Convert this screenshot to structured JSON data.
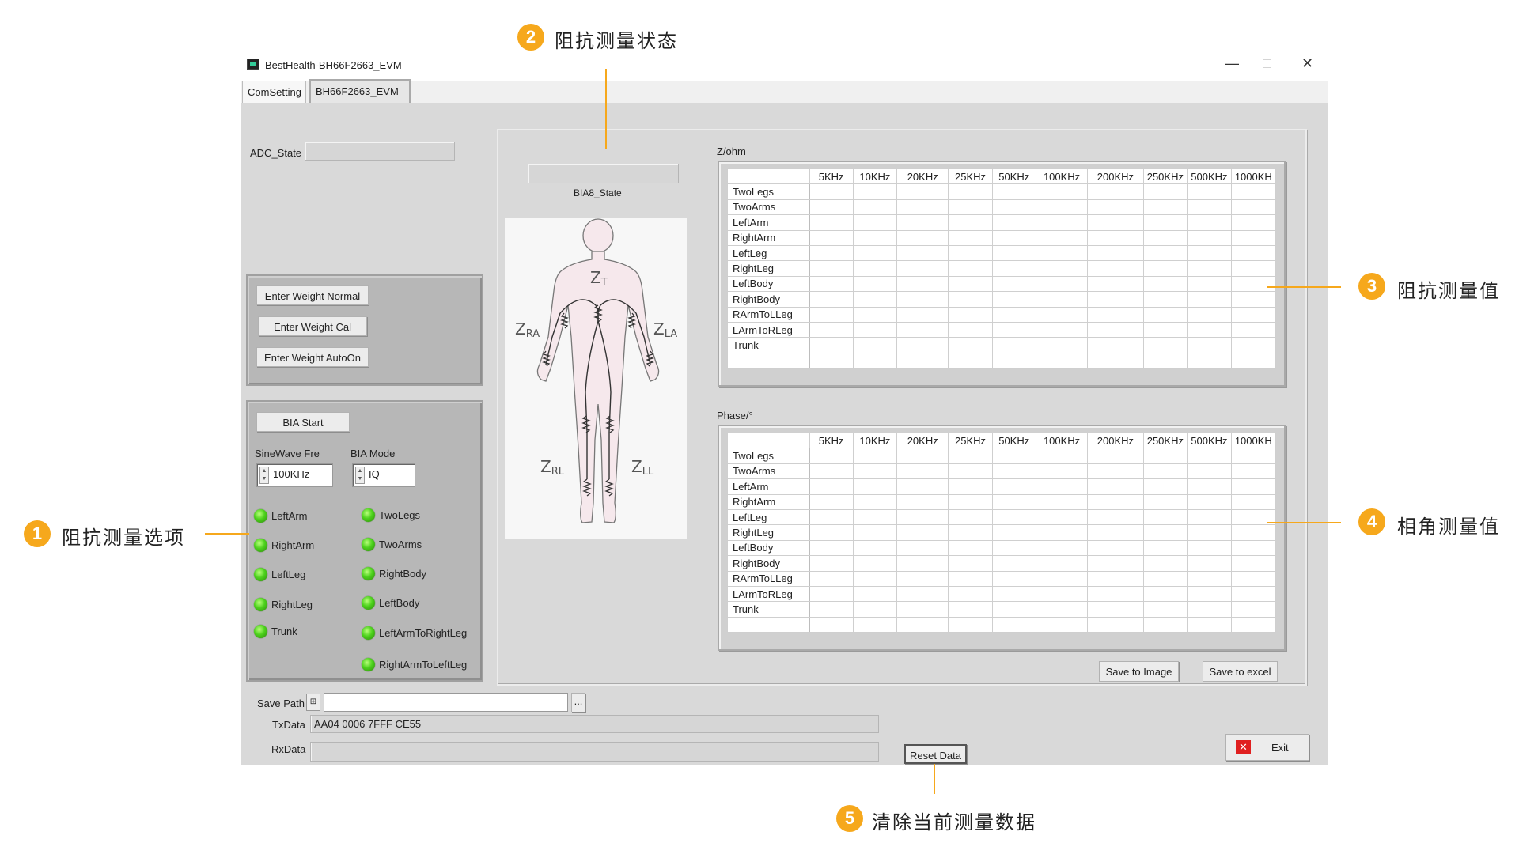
{
  "window": {
    "title": "BestHealth-BH66F2663_EVM",
    "controls": [
      "—",
      "□",
      "✕"
    ]
  },
  "tabs": [
    {
      "label": "ComSetting"
    },
    {
      "label": "BH66F2663_EVM",
      "active": true
    }
  ],
  "left": {
    "adc_state_label": "ADC_State",
    "adc_state_value": "",
    "weight_buttons": [
      "Enter Weight Normal",
      "Enter Weight Cal",
      "Enter Weight AutoOn"
    ],
    "bia_start_label": "BIA Start",
    "sinewave_label": "SineWave Fre",
    "sinewave_value": "100KHz",
    "bia_mode_label": "BIA Mode",
    "bia_mode_value": "IQ",
    "leds_left": [
      "LeftArm",
      "RightArm",
      "LeftLeg",
      "RightLeg",
      "Trunk"
    ],
    "leds_right": [
      "TwoLegs",
      "TwoArms",
      "RightBody",
      "LeftBody",
      "LeftArmToRightLeg",
      "RightArmToLeftLeg"
    ]
  },
  "center": {
    "bia8_state_label": "BIA8_State",
    "bia8_state_value": "",
    "figure_labels": {
      "zt": "Z",
      "zt_sub": "T",
      "zra": "Z",
      "zra_sub": "RA",
      "zla": "Z",
      "zla_sub": "LA",
      "zrl": "Z",
      "zrl_sub": "RL",
      "zll": "Z",
      "zll_sub": "LL"
    }
  },
  "tables": {
    "columns": [
      "5KHz",
      "10KHz",
      "20KHz",
      "25KHz",
      "50KHz",
      "100KHz",
      "200KHz",
      "250KHz",
      "500KHz",
      "1000KH"
    ],
    "rows": [
      "TwoLegs",
      "TwoArms",
      "LeftArm",
      "RightArm",
      "LeftLeg",
      "RightLeg",
      "LeftBody",
      "RightBody",
      "RArmToLLeg",
      "LArmToRLeg",
      "Trunk"
    ],
    "impedance_title": "Z/ohm",
    "phase_title": "Phase/°"
  },
  "buttons": {
    "save_image": "Save to Image",
    "save_excel": "Save to excel",
    "reset_data": "Reset Data",
    "exit": "Exit",
    "browse": "..."
  },
  "bottom": {
    "save_path_label": "Save Path",
    "save_path_value": "",
    "txdata_label": "TxData",
    "txdata_value": "AA04 0006 7FFF CE55",
    "rxdata_label": "RxData",
    "rxdata_value": ""
  },
  "callouts": [
    {
      "num": "1",
      "text": "阻抗测量选项"
    },
    {
      "num": "2",
      "text": "阻抗测量状态"
    },
    {
      "num": "3",
      "text": "阻抗测量值"
    },
    {
      "num": "4",
      "text": "相角测量值"
    },
    {
      "num": "5",
      "text": "清除当前测量数据"
    }
  ],
  "colors": {
    "callout": "#f6a81c",
    "led_on": "#4cd11c",
    "panel": "#d9d9d9",
    "group": "#b7b7b7"
  }
}
